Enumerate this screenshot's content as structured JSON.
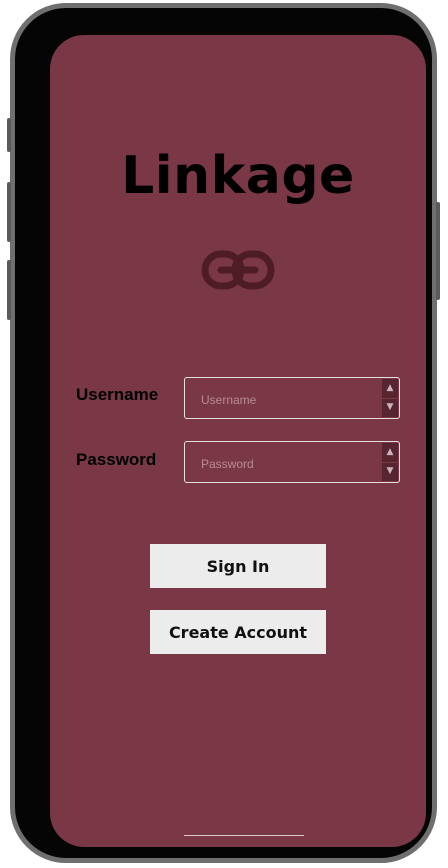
{
  "app": {
    "title": "Linkage",
    "icon": "link-icon"
  },
  "form": {
    "username": {
      "label": "Username",
      "placeholder": "Username",
      "value": ""
    },
    "password": {
      "label": "Password",
      "placeholder": "Password",
      "value": ""
    }
  },
  "actions": {
    "sign_in_label": "Sign In",
    "create_account_label": "Create Account"
  },
  "colors": {
    "screen_background": "#7a3846",
    "logo": "#4e1c27",
    "button_background": "#ececec",
    "phone_frame": "#050505"
  }
}
